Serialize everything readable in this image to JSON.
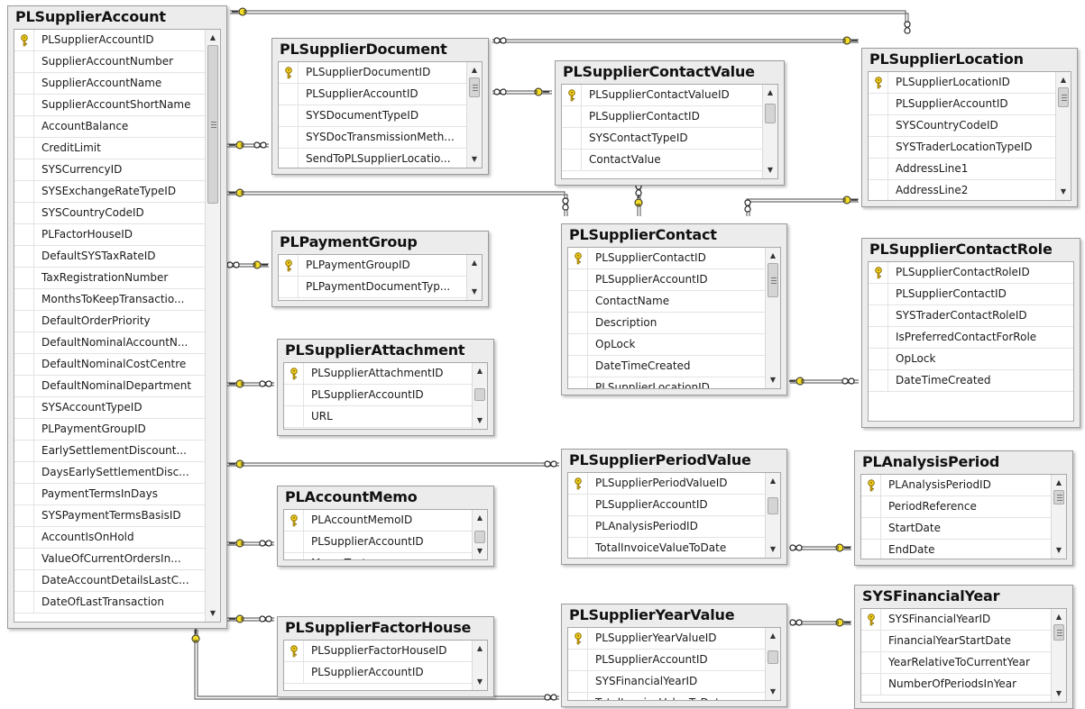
{
  "tables": [
    {
      "id": "PLSupplierAccount",
      "title": "PLSupplierAccount",
      "scroll": {
        "thumb_top": 0.0,
        "thumb_size": 0.28,
        "grip": true
      },
      "columns": [
        "PLSupplierAccountID",
        "SupplierAccountNumber",
        "SupplierAccountName",
        "SupplierAccountShortName",
        "AccountBalance",
        "CreditLimit",
        "SYSCurrencyID",
        "SYSExchangeRateTypeID",
        "SYSCountryCodeID",
        "PLFactorHouseID",
        "DefaultSYSTaxRateID",
        "TaxRegistrationNumber",
        "MonthsToKeepTransactio...",
        "DefaultOrderPriority",
        "DefaultNominalAccountN...",
        "DefaultNominalCostCentre",
        "DefaultNominalDepartment",
        "SYSAccountTypeID",
        "PLPaymentGroupID",
        "EarlySettlementDiscount...",
        "DaysEarlySettlementDisc...",
        "PaymentTermsInDays",
        "SYSPaymentTermsBasisID",
        "AccountIsOnHold",
        "ValueOfCurrentOrdersIn...",
        "DateAccountDetailsLastC...",
        "DateOfLastTransaction"
      ],
      "keys": [
        0
      ]
    },
    {
      "id": "PLSupplierDocument",
      "title": "PLSupplierDocument",
      "scroll": {
        "thumb_top": 0.0,
        "thumb_size": 0.25,
        "grip": true
      },
      "columns": [
        "PLSupplierDocumentID",
        "PLSupplierAccountID",
        "SYSDocumentTypeID",
        "SYSDocTransmissionMeth...",
        "SendToPLSupplierLocatio..."
      ],
      "keys": [
        0
      ]
    },
    {
      "id": "PLSupplierContactValue",
      "title": "PLSupplierContactValue",
      "scroll": {
        "thumb_top": 0.05,
        "thumb_size": 0.3,
        "grip": false
      },
      "columns": [
        "PLSupplierContactValueID",
        "PLSupplierContactID",
        "SYSContactTypeID",
        "ContactValue"
      ],
      "keys": [
        0
      ]
    },
    {
      "id": "PLSupplierLocation",
      "title": "PLSupplierLocation",
      "scroll": {
        "thumb_top": 0.0,
        "thumb_size": 0.2,
        "grip": true
      },
      "columns": [
        "PLSupplierLocationID",
        "PLSupplierAccountID",
        "SYSCountryCodeID",
        "SYSTraderLocationTypeID",
        "AddressLine1",
        "AddressLine2"
      ],
      "keys": [
        0
      ]
    },
    {
      "id": "PLPaymentGroup",
      "title": "PLPaymentGroup",
      "scroll": {
        "thumb_top": 0.0,
        "thumb_size": 0.0,
        "grip": false
      },
      "columns": [
        "PLPaymentGroupID",
        "PLPaymentDocumentTyp..."
      ],
      "keys": [
        0
      ]
    },
    {
      "id": "PLSupplierContact",
      "title": "PLSupplierContact",
      "scroll": {
        "thumb_top": 0.0,
        "thumb_size": 0.3,
        "grip": true
      },
      "columns": [
        "PLSupplierContactID",
        "PLSupplierAccountID",
        "ContactName",
        "Description",
        "OpLock",
        "DateTimeCreated",
        "PLSupplierLocationID"
      ],
      "keys": [
        0
      ]
    },
    {
      "id": "PLSupplierContactRole",
      "title": "PLSupplierContactRole",
      "scroll": null,
      "columns": [
        "PLSupplierContactRoleID",
        "PLSupplierContactID",
        "SYSTraderContactRoleID",
        "IsPreferredContactForRole",
        "OpLock",
        "DateTimeCreated"
      ],
      "keys": [
        0
      ]
    },
    {
      "id": "PLSupplierAttachment",
      "title": "PLSupplierAttachment",
      "scroll": {
        "thumb_top": 0.25,
        "thumb_size": 0.32,
        "grip": false
      },
      "columns": [
        "PLSupplierAttachmentID",
        "PLSupplierAccountID",
        "URL"
      ],
      "keys": [
        0
      ]
    },
    {
      "id": "PLSupplierPeriodValue",
      "title": "PLSupplierPeriodValue",
      "scroll": {
        "thumb_top": 0.15,
        "thumb_size": 0.3,
        "grip": false
      },
      "columns": [
        "PLSupplierPeriodValueID",
        "PLSupplierAccountID",
        "PLAnalysisPeriodID",
        "TotalInvoiceValueToDate"
      ],
      "keys": [
        0
      ]
    },
    {
      "id": "PLAnalysisPeriod",
      "title": "PLAnalysisPeriod",
      "scroll": {
        "thumb_top": 0.0,
        "thumb_size": 0.25,
        "grip": true
      },
      "columns": [
        "PLAnalysisPeriodID",
        "PeriodReference",
        "StartDate",
        "EndDate"
      ],
      "keys": [
        0
      ]
    },
    {
      "id": "PLAccountMemo",
      "title": "PLAccountMemo",
      "scroll": {
        "thumb_top": 0.25,
        "thumb_size": 0.32,
        "grip": false
      },
      "columns": [
        "PLAccountMemoID",
        "PLSupplierAccountID",
        "MemoText"
      ],
      "keys": [
        0
      ]
    },
    {
      "id": "PLSupplierFactorHouse",
      "title": "PLSupplierFactorHouse",
      "scroll": {
        "thumb_top": 0.0,
        "thumb_size": 0.0,
        "grip": false
      },
      "columns": [
        "PLSupplierFactorHouseID",
        "PLSupplierAccountID"
      ],
      "keys": [
        0
      ]
    },
    {
      "id": "PLSupplierYearValue",
      "title": "PLSupplierYearValue",
      "scroll": {
        "thumb_top": 0.15,
        "thumb_size": 0.3,
        "grip": false
      },
      "columns": [
        "PLSupplierYearValueID",
        "PLSupplierAccountID",
        "SYSFinancialYearID",
        "TotalInvoiceValueToDate"
      ],
      "keys": [
        0
      ]
    },
    {
      "id": "SYSFinancialYear",
      "title": "SYSFinancialYear",
      "scroll": {
        "thumb_top": 0.0,
        "thumb_size": 0.25,
        "grip": true
      },
      "columns": [
        "SYSFinancialYearID",
        "FinancialYearStartDate",
        "YearRelativeToCurrentYear",
        "NumberOfPeriodsInYear"
      ],
      "keys": [
        0
      ]
    }
  ],
  "relationships": [
    {
      "from": "PLSupplierAccount",
      "to": "PLSupplierDocument"
    },
    {
      "from": "PLSupplierAccount",
      "to": "PLSupplierLocation"
    },
    {
      "from": "PLSupplierLocation",
      "to": "PLSupplierDocument"
    },
    {
      "from": "PLSupplierContact",
      "to": "PLSupplierContactValue"
    },
    {
      "from": "PLSupplierAccount",
      "to": "PLSupplierContact"
    },
    {
      "from": "PLSupplierLocation",
      "to": "PLSupplierContact"
    },
    {
      "from": "PLPaymentGroup",
      "to": "PLSupplierAccount"
    },
    {
      "from": "PLSupplierAccount",
      "to": "PLSupplierAttachment"
    },
    {
      "from": "PLSupplierContact",
      "to": "PLSupplierContactRole"
    },
    {
      "from": "PLSupplierAccount",
      "to": "PLSupplierPeriodValue"
    },
    {
      "from": "PLAnalysisPeriod",
      "to": "PLSupplierPeriodValue"
    },
    {
      "from": "PLSupplierAccount",
      "to": "PLAccountMemo"
    },
    {
      "from": "PLSupplierAccount",
      "to": "PLSupplierFactorHouse"
    },
    {
      "from": "SYSFinancialYear",
      "to": "PLSupplierYearValue"
    },
    {
      "from": "PLSupplierAccount",
      "to": "PLSupplierYearValue"
    }
  ]
}
